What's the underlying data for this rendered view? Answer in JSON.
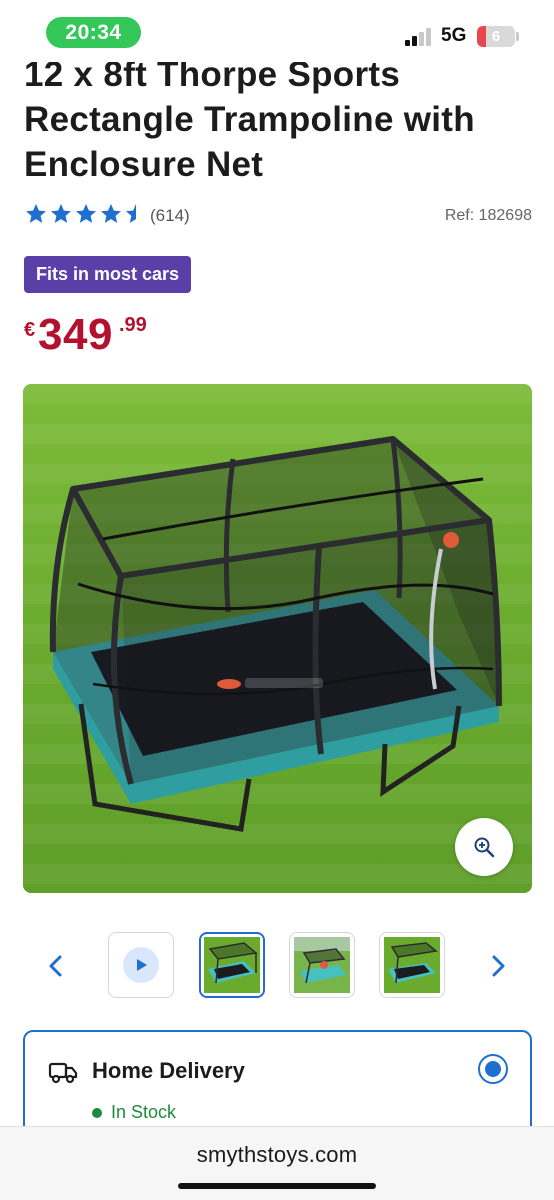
{
  "status_bar": {
    "time": "20:34",
    "network": "5G",
    "battery_level": "6",
    "battery_color": "#e5484d",
    "time_pill_color": "#34c759"
  },
  "product": {
    "title_lines": [
      "12 x 8ft Thorpe Sports",
      "Rectangle Trampoline with",
      "Enclosure Net"
    ],
    "rating_stars": 4.5,
    "rating_max": 5,
    "review_count": "(614)",
    "ref": "Ref: 182698",
    "badge": "Fits in most cars",
    "badge_color": "#5a3fa8",
    "price": {
      "currency": "€",
      "whole": "349",
      "decimal": ".99",
      "color": "#b3122e"
    },
    "main_image": "trampoline-photo",
    "zoom_icon": "zoom-in-icon"
  },
  "gallery": {
    "prev_icon": "chevron-left-icon",
    "next_icon": "chevron-right-icon",
    "thumbnails": [
      {
        "kind": "video",
        "icon": "play-icon"
      },
      {
        "kind": "image",
        "selected": true
      },
      {
        "kind": "image",
        "selected": false
      },
      {
        "kind": "image",
        "selected": false
      }
    ]
  },
  "delivery": {
    "option_title": "Home Delivery",
    "icon": "truck-icon",
    "stock_status": "In Stock",
    "selected": true,
    "accent_color": "#1f6fd1",
    "stock_color": "#1f8a3e"
  },
  "browser": {
    "domain": "smythstoys.com"
  }
}
